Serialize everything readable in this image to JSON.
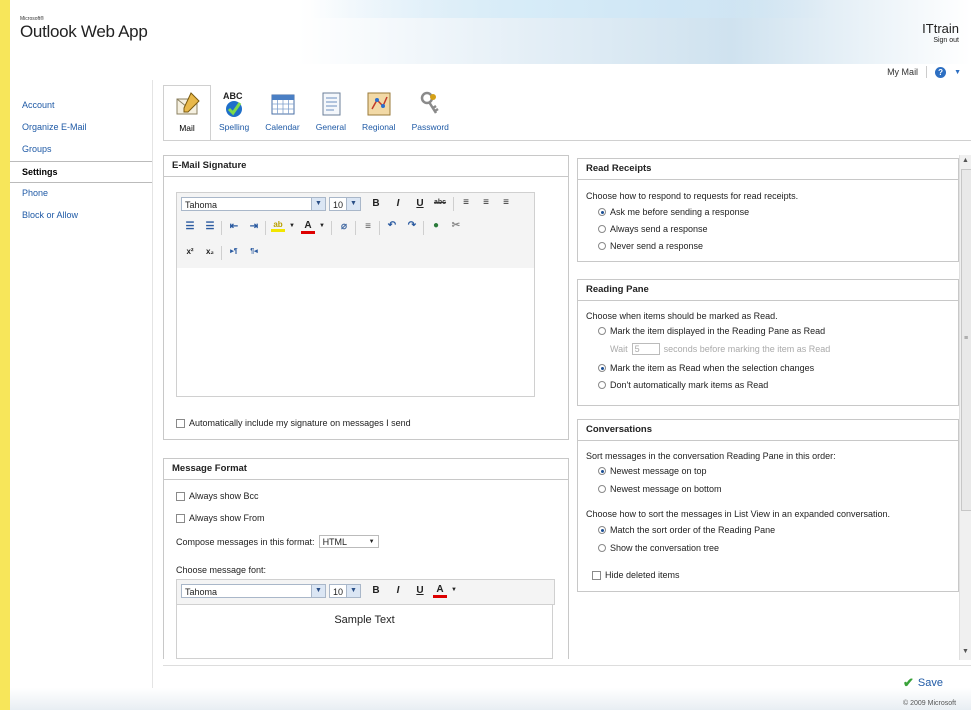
{
  "app": {
    "logo_small": "Microsoft®",
    "logo": "Outlook Web App",
    "user_name": "ITtrain",
    "sign_out": "Sign out",
    "my_mail": "My Mail",
    "help": "?",
    "copyright": "© 2009 Microsoft"
  },
  "leftnav": {
    "items": [
      {
        "label": "Account"
      },
      {
        "label": "Organize E-Mail"
      },
      {
        "label": "Groups"
      },
      {
        "label": "Settings",
        "selected": true
      },
      {
        "label": "Phone"
      },
      {
        "label": "Block or Allow"
      }
    ]
  },
  "tabs": [
    {
      "label": "Mail",
      "icon": "mail-pen-icon",
      "selected": true
    },
    {
      "label": "Spelling",
      "icon": "spelling-check-icon"
    },
    {
      "label": "Calendar",
      "icon": "calendar-grid-icon"
    },
    {
      "label": "General",
      "icon": "general-document-icon"
    },
    {
      "label": "Regional",
      "icon": "regional-map-icon"
    },
    {
      "label": "Password",
      "icon": "keys-icon"
    }
  ],
  "signature": {
    "title": "E-Mail Signature",
    "font": "Tahoma",
    "size": "10",
    "auto_include_label": "Automatically include my signature on messages I send",
    "auto_include_checked": false
  },
  "message_format": {
    "title": "Message Format",
    "always_bcc": "Always show Bcc",
    "always_from": "Always show From",
    "compose_label": "Compose messages in this format:",
    "compose_value": "HTML",
    "font_label": "Choose message font:",
    "font": "Tahoma",
    "size": "10",
    "sample": "Sample Text"
  },
  "read_receipts": {
    "title": "Read Receipts",
    "prompt": "Choose how to respond to requests for read receipts.",
    "options": [
      "Ask me before sending a response",
      "Always send a response",
      "Never send a response"
    ],
    "selected": 0
  },
  "reading_pane": {
    "title": "Reading Pane",
    "prompt": "Choose when items should be marked as Read.",
    "opt1": "Mark the item displayed in the Reading Pane as Read",
    "wait_label": "Wait",
    "wait_value": "5",
    "wait_suffix": "seconds before marking the item as Read",
    "opt2": "Mark the item as Read when the selection changes",
    "opt3": "Don't automatically mark items as Read",
    "selected": 1
  },
  "conversations": {
    "title": "Conversations",
    "prompt1": "Sort messages in the conversation Reading Pane in this order:",
    "order_options": [
      "Newest message on top",
      "Newest message on bottom"
    ],
    "order_selected": 0,
    "prompt2": "Choose how to sort the messages in List View in an expanded conversation.",
    "list_options": [
      "Match the sort order of the Reading Pane",
      "Show the conversation tree"
    ],
    "list_selected": 0,
    "hide_deleted": "Hide deleted items"
  },
  "footer": {
    "save_label": "Save"
  },
  "colors": {
    "accent_yellow": "#f7e65a",
    "link_blue": "#1f5aa6",
    "save_green": "#3aa23a"
  }
}
